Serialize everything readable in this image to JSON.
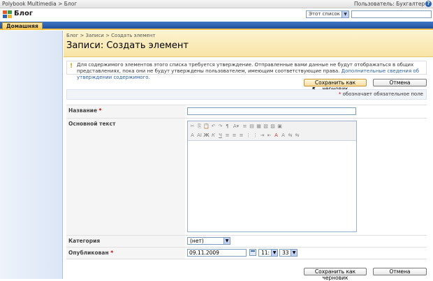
{
  "global": {
    "breadcrumb": "Polybook Multimedia > Блог",
    "user_label": "Пользователь: Бухгалтер ▾",
    "help_glyph": "?"
  },
  "header": {
    "site_title": "Блог",
    "scope_select": "Этот список",
    "search_placeholder": ""
  },
  "tabs": {
    "home": "Домашняя"
  },
  "page": {
    "breadcrumb": "Блог > Записи > Создать элемент",
    "title": "Записи: Создать элемент"
  },
  "notice": {
    "icon": "!",
    "text": "Для содержимого элементов этого списка требуется утверждение. Отправленные вами данные не будут отображаться в общих представлениях, пока они не будут утверждены пользователем, имеющим соответствующие права.",
    "link": "Дополнительные сведения об утверждении содержимого."
  },
  "buttons": {
    "save_draft": "Сохранить как черновик",
    "cancel": "Отмена"
  },
  "required_note": {
    "star": "*",
    "text": " обозначает обязательное поле"
  },
  "form": {
    "title_label": "Название",
    "title_value": "",
    "body_label": "Основной текст",
    "category_label": "Категория",
    "category_value": "(нет)",
    "published_label": "Опубликован",
    "published_date": "09.11.2009",
    "published_hour": "11:",
    "published_minute": "33"
  },
  "rte_toolbar": {
    "row1": [
      "✂",
      "⎘",
      "📋",
      "↶",
      "↷",
      "¶",
      "A▾",
      "≡",
      "▤",
      "▦",
      "▧",
      "▨",
      "▣"
    ],
    "row2": [
      "A",
      "AI",
      "Ж",
      "К",
      "Ч",
      "≡",
      "≡",
      "≡",
      "⋮",
      "⋮",
      "⇥",
      "⇤",
      "A",
      "A",
      "⇆",
      "⇆"
    ]
  }
}
